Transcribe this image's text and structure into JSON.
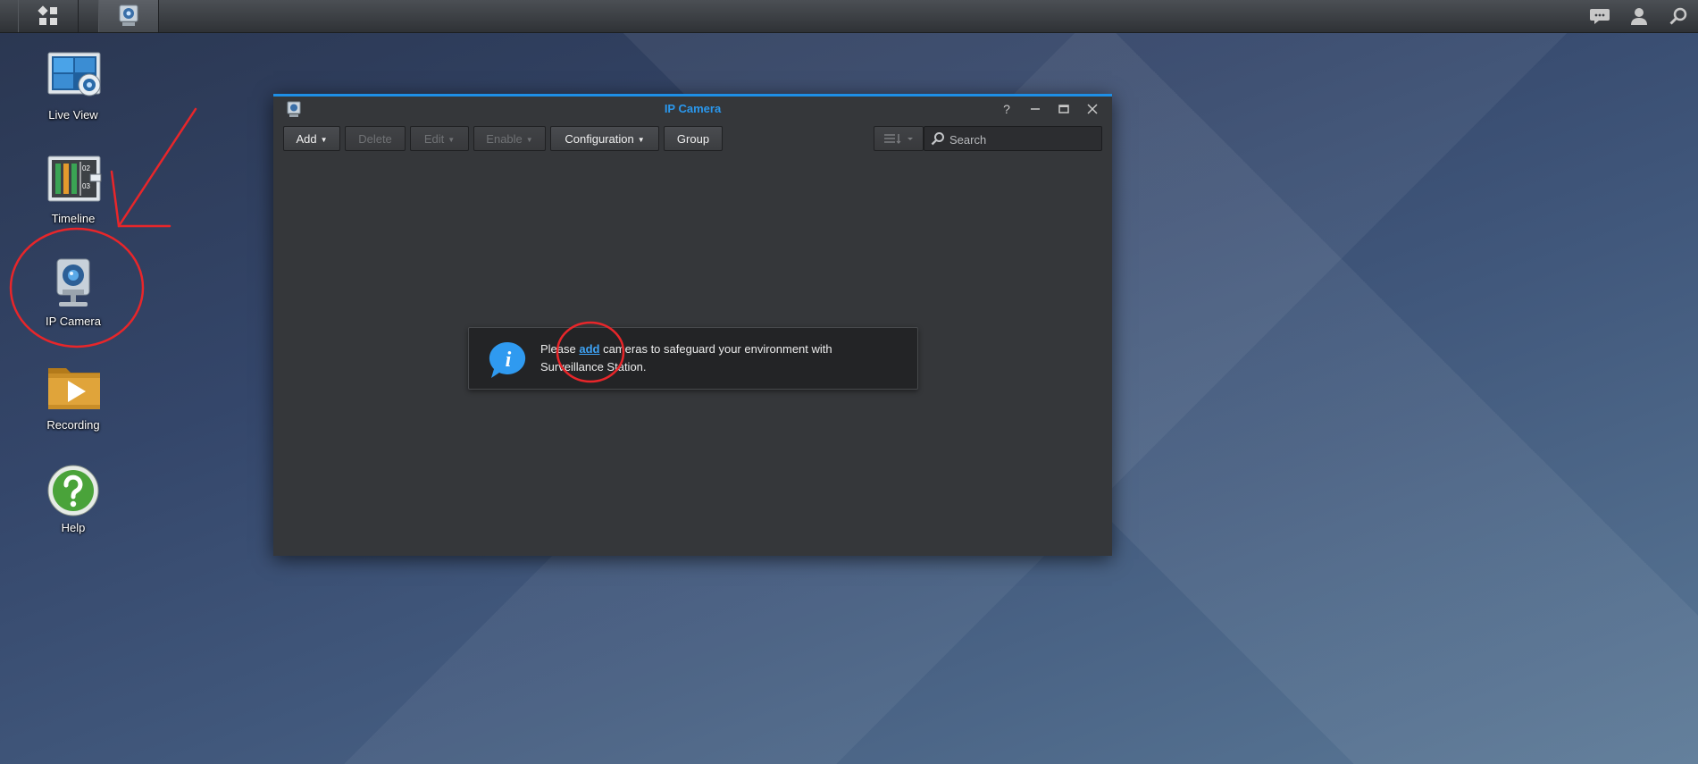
{
  "desktop": {
    "icons": [
      {
        "label": "Live View"
      },
      {
        "label": "Timeline"
      },
      {
        "label": "IP Camera"
      },
      {
        "label": "Recording"
      },
      {
        "label": "Help"
      }
    ],
    "timeline_marks": [
      "02",
      "03"
    ]
  },
  "window": {
    "title": "IP Camera",
    "help_glyph": "?",
    "toolbar": {
      "add": "Add",
      "delete": "Delete",
      "edit": "Edit",
      "enable": "Enable",
      "configuration": "Configuration",
      "group": "Group"
    },
    "search": {
      "placeholder": "Search"
    },
    "message": {
      "prefix": "Please ",
      "link": "add",
      "suffix": " cameras to safeguard your environment with Surveillance Station.",
      "info_glyph": "i"
    }
  },
  "annotation_color": "#e8262a",
  "accent_color": "#1e8fe6"
}
